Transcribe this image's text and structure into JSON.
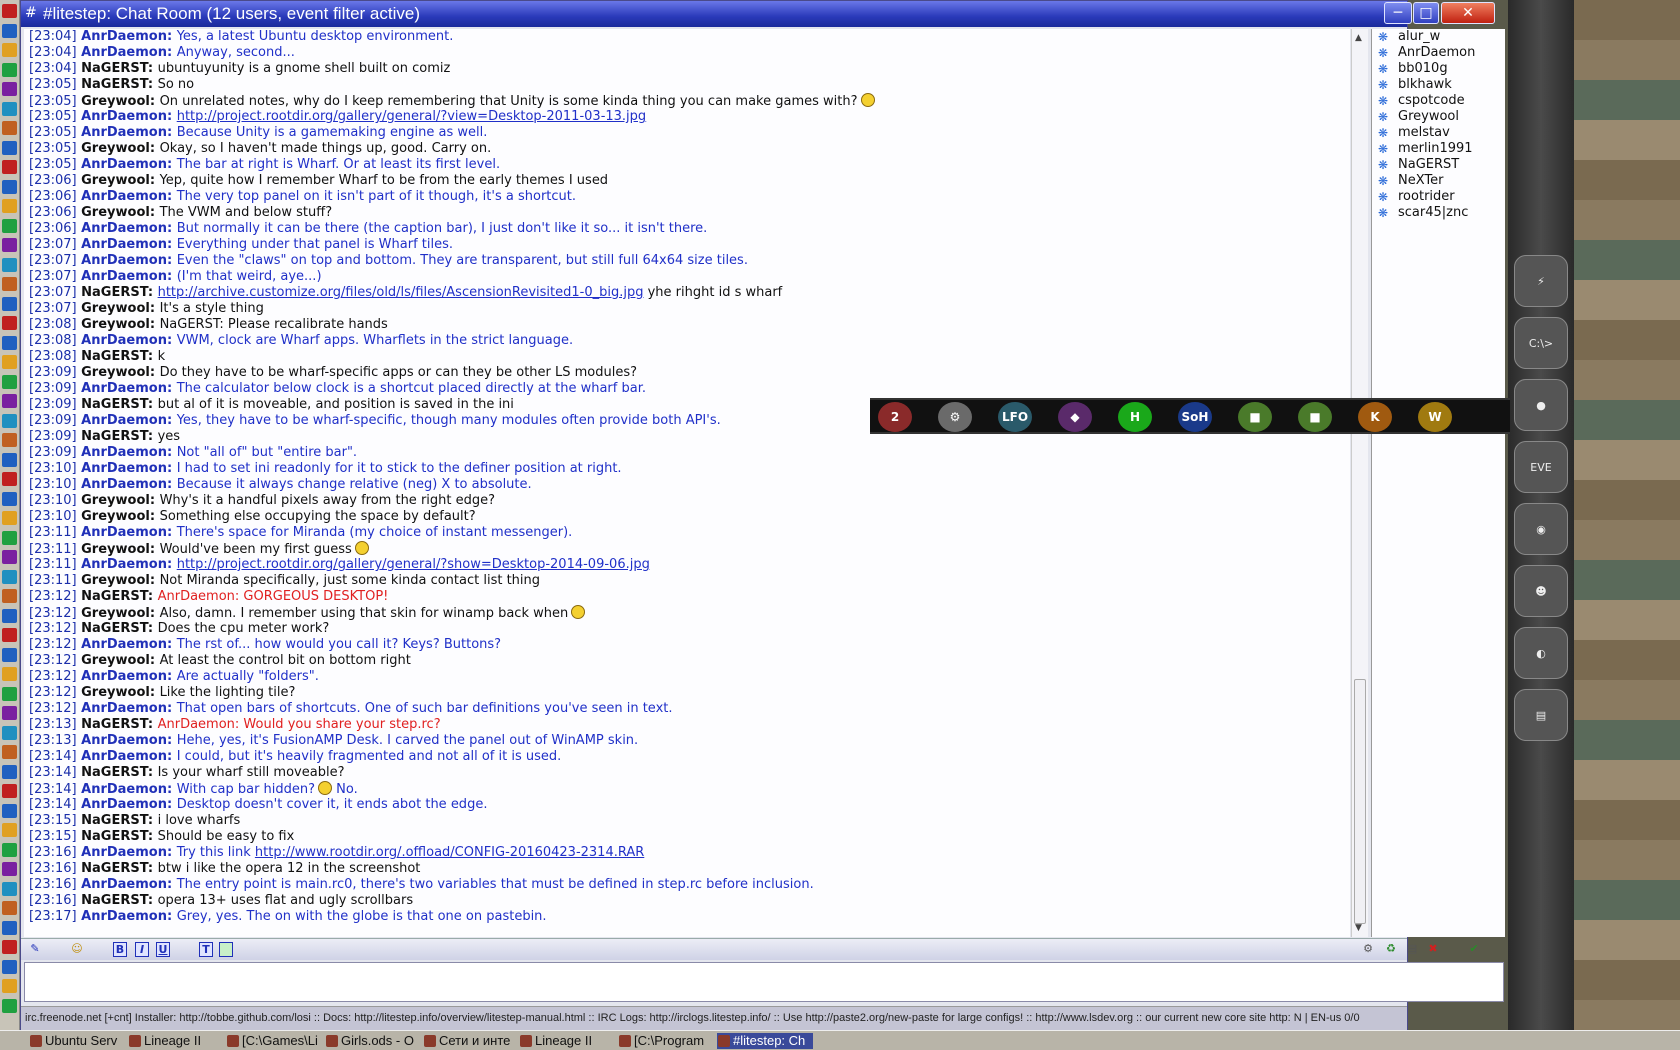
{
  "window": {
    "title": "#litestep: Chat Room (12 users, event filter active)",
    "min_label": "─",
    "max_label": "□",
    "close_label": "✕"
  },
  "messages": [
    {
      "time": "[23:04]",
      "nick": "AnrDaemon:",
      "self": true,
      "text": "Yes, a latest Ubuntu desktop environment."
    },
    {
      "time": "[23:04]",
      "nick": "AnrDaemon:",
      "self": true,
      "text": "Anyway, second..."
    },
    {
      "time": "[23:04]",
      "nick": "NaGERST:",
      "self": false,
      "text": "ubuntuyunity is a gnome shell built on comiz"
    },
    {
      "time": "[23:05]",
      "nick": "NaGERST:",
      "self": false,
      "text": "So no"
    },
    {
      "time": "[23:05]",
      "nick": "Greywool:",
      "self": false,
      "text": "On unrelated notes, why do I keep remembering that Unity is some kinda thing you can make games with?",
      "smiley": true
    },
    {
      "time": "[23:05]",
      "nick": "AnrDaemon:",
      "self": true,
      "link": "http://project.rootdir.org/gallery/general/?view=Desktop-2011-03-13.jpg"
    },
    {
      "time": "[23:05]",
      "nick": "AnrDaemon:",
      "self": true,
      "text": "Because Unity is a gamemaking engine as well."
    },
    {
      "time": "[23:05]",
      "nick": "Greywool:",
      "self": false,
      "text": "Okay, so I haven't made things up, good. Carry on."
    },
    {
      "time": "[23:05]",
      "nick": "AnrDaemon:",
      "self": true,
      "text": "The bar at right is Wharf. Or at least its first level."
    },
    {
      "time": "[23:06]",
      "nick": "Greywool:",
      "self": false,
      "text": "Yep, quite how I remember Wharf to be from the early themes I  used"
    },
    {
      "time": "[23:06]",
      "nick": "AnrDaemon:",
      "self": true,
      "text": "The very top panel on it isn't part of it though, it's a shortcut."
    },
    {
      "time": "[23:06]",
      "nick": "Greywool:",
      "self": false,
      "text": "The VWM and below stuff?"
    },
    {
      "time": "[23:06]",
      "nick": "AnrDaemon:",
      "self": true,
      "text": "But normally it can be there (the caption bar), I just don't like it so... it isn't there."
    },
    {
      "time": "[23:07]",
      "nick": "AnrDaemon:",
      "self": true,
      "text": "Everything under that panel is Wharf tiles."
    },
    {
      "time": "[23:07]",
      "nick": "AnrDaemon:",
      "self": true,
      "text": "Even the \"claws\" on top and bottom. They are transparent, but still full 64x64 size tiles."
    },
    {
      "time": "[23:07]",
      "nick": "AnrDaemon:",
      "self": true,
      "text": "(I'm that weird, aye...)"
    },
    {
      "time": "[23:07]",
      "nick": "NaGERST:",
      "self": false,
      "link": "http://archive.customize.org/files/old/ls/files/AscensionRevisited1-0_big.jpg",
      "text": " yhe rihght id s wharf"
    },
    {
      "time": "[23:07]",
      "nick": "Greywool:",
      "self": false,
      "text": "It's a style thing"
    },
    {
      "time": "[23:08]",
      "nick": "Greywool:",
      "self": false,
      "text": "NaGERST: Please recalibrate hands"
    },
    {
      "time": "[23:08]",
      "nick": "AnrDaemon:",
      "self": true,
      "text": "VWM, clock are Wharf apps. Wharflets in the strict language."
    },
    {
      "time": "[23:08]",
      "nick": "NaGERST:",
      "self": false,
      "text": "k"
    },
    {
      "time": "[23:09]",
      "nick": "Greywool:",
      "self": false,
      "text": "Do they have to be wharf-specific apps or can they be other LS modules?"
    },
    {
      "time": "[23:09]",
      "nick": "AnrDaemon:",
      "self": true,
      "text": "The calculator below clock is a shortcut placed directly at the wharf bar."
    },
    {
      "time": "[23:09]",
      "nick": "NaGERST:",
      "self": false,
      "text": "but al of it is moveable, and position is saved in the ini"
    },
    {
      "time": "[23:09]",
      "nick": "AnrDaemon:",
      "self": true,
      "text": "Yes, they have to be wharf-specific, though many modules often provide both API's."
    },
    {
      "time": "[23:09]",
      "nick": "NaGERST:",
      "self": false,
      "text": "yes"
    },
    {
      "time": "[23:09]",
      "nick": "AnrDaemon:",
      "self": true,
      "text": "Not \"all of\" but \"entire bar\"."
    },
    {
      "time": "[23:10]",
      "nick": "AnrDaemon:",
      "self": true,
      "text": "I had to set ini readonly for it to stick to the definer position at right."
    },
    {
      "time": "[23:10]",
      "nick": "AnrDaemon:",
      "self": true,
      "text": "Because it always change relative (neg) X to absolute."
    },
    {
      "time": "[23:10]",
      "nick": "Greywool:",
      "self": false,
      "text": "Why's it a handful pixels away from the right edge?"
    },
    {
      "time": "[23:10]",
      "nick": "Greywool:",
      "self": false,
      "text": "Something else occupying the space by default?"
    },
    {
      "time": "[23:11]",
      "nick": "AnrDaemon:",
      "self": true,
      "text": "There's space for Miranda (my choice of instant messenger)."
    },
    {
      "time": "[23:11]",
      "nick": "Greywool:",
      "self": false,
      "text": "Would've been my first guess",
      "smiley": true
    },
    {
      "time": "[23:11]",
      "nick": "AnrDaemon:",
      "self": true,
      "link": "http://project.rootdir.org/gallery/general/?show=Desktop-2014-09-06.jpg"
    },
    {
      "time": "[23:11]",
      "nick": "Greywool:",
      "self": false,
      "text": "Not Miranda specifically, just some kinda contact list thing"
    },
    {
      "time": "[23:12]",
      "nick": "NaGERST:",
      "self": false,
      "text": "AnrDaemon: GORGEOUS DESKTOP!",
      "hl": true
    },
    {
      "time": "[23:12]",
      "nick": "Greywool:",
      "self": false,
      "text": "Also, damn. I remember using that skin for winamp back when",
      "smiley": true
    },
    {
      "time": "[23:12]",
      "nick": "NaGERST:",
      "self": false,
      "text": "Does the cpu meter work?"
    },
    {
      "time": "[23:12]",
      "nick": "AnrDaemon:",
      "self": true,
      "text": "The rst of... how would you call it? Keys? Buttons?"
    },
    {
      "time": "[23:12]",
      "nick": "Greywool:",
      "self": false,
      "text": "At least the control bit on bottom right"
    },
    {
      "time": "[23:12]",
      "nick": "AnrDaemon:",
      "self": true,
      "text": "Are actually \"folders\"."
    },
    {
      "time": "[23:12]",
      "nick": "Greywool:",
      "self": false,
      "text": "Like the lighting tile?"
    },
    {
      "time": "[23:12]",
      "nick": "AnrDaemon:",
      "self": true,
      "text": "That open bars of shortcuts. One of such bar definitions you've seen in text."
    },
    {
      "time": "[23:13]",
      "nick": "NaGERST:",
      "self": false,
      "text": "AnrDaemon: Would you share your step.rc?",
      "hl": true
    },
    {
      "time": "[23:13]",
      "nick": "AnrDaemon:",
      "self": true,
      "text": "Hehe, yes, it's FusionAMP Desk. I carved the panel out of WinAMP skin."
    },
    {
      "time": "[23:14]",
      "nick": "AnrDaemon:",
      "self": true,
      "text": "I could, but it's heavily fragmented and not all of it is used."
    },
    {
      "time": "[23:14]",
      "nick": "NaGERST:",
      "self": false,
      "text": "Is your wharf still moveable?"
    },
    {
      "time": "[23:14]",
      "nick": "AnrDaemon:",
      "self": true,
      "text": "With cap bar hidden?",
      "smiley_after": " No."
    },
    {
      "time": "[23:14]",
      "nick": "AnrDaemon:",
      "self": true,
      "text": "Desktop doesn't cover it, it ends abot the edge."
    },
    {
      "time": "[23:15]",
      "nick": "NaGERST:",
      "self": false,
      "text": "i love wharfs"
    },
    {
      "time": "[23:15]",
      "nick": "NaGERST:",
      "self": false,
      "text": "Should be easy to fix"
    },
    {
      "time": "[23:16]",
      "nick": "AnrDaemon:",
      "self": true,
      "text": "Try this link ",
      "link_after": "http://www.rootdir.org/.offload/CONFIG-20160423-2314.RAR"
    },
    {
      "time": "[23:16]",
      "nick": "NaGERST:",
      "self": false,
      "text": "btw i like the opera 12 in the screenshot"
    },
    {
      "time": "[23:16]",
      "nick": "AnrDaemon:",
      "self": true,
      "text": "The entry point is main.rc0, there's two variables that must be defined in step.rc before inclusion."
    },
    {
      "time": "[23:16]",
      "nick": "NaGERST:",
      "self": false,
      "text": "opera 13+ uses flat and ugly scrollbars"
    },
    {
      "time": "[23:17]",
      "nick": "AnrDaemon:",
      "self": true,
      "text": "Grey, yes. The on with the globe is that one on pastebin."
    }
  ],
  "users": [
    "alur_w",
    "AnrDaemon",
    "bb010g",
    "blkhawk",
    "cspotcode",
    "Greywool",
    "melstav",
    "merlin1991",
    "NaGERST",
    "NeXTer",
    "rootrider",
    "scar45|znc"
  ],
  "toolbar": {
    "bold": "B",
    "italic": "I",
    "underline": "U",
    "text": "T"
  },
  "input": {
    "value": ""
  },
  "status": {
    "text": "irc.freenode.net [+cnt] Installer: http://tobbe.github.com/losi  ::  Docs: http://litestep.info/overview/litestep-manual.html  ::  IRC Logs: http://irclogs.litestep.info/  ::  Use http://paste2.org/new-paste for large configs!  ::  http://www.lsdev.org  ::  our current new core site http:     N | EN-us 0/0"
  },
  "wharf": [
    "2",
    "⚙",
    "LFO",
    "◆",
    "H",
    "SoH",
    "■",
    "■",
    "K",
    "W"
  ],
  "dock": [
    "⚡",
    "C:\\>",
    "●",
    "EVE",
    "◉",
    "☻",
    "◐",
    "▤"
  ],
  "taskbar": [
    "Ubuntu Serv",
    "Lineage II",
    "[C:\\Games\\Li",
    "Girls.ods - O",
    "Сети и инте",
    "Lineage II",
    "[C:\\Program",
    "#litestep: Ch"
  ],
  "colors": {
    "title_gradient_top": "#6a78e8",
    "nick_self": "#2030b8",
    "timestamp": "#1a2eaa",
    "highlight": "#e02020"
  }
}
